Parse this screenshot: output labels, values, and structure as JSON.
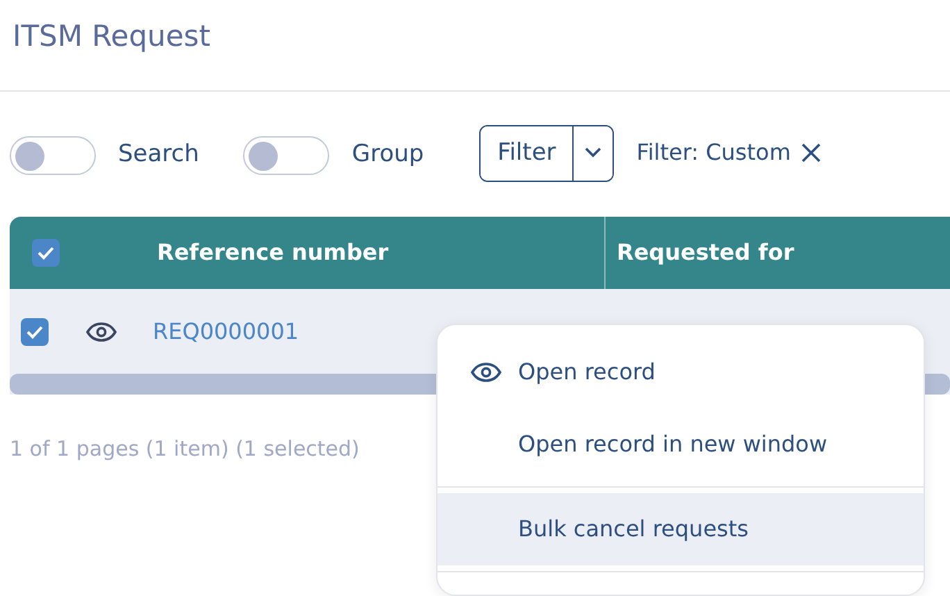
{
  "title": "ITSM Request",
  "toggles": [
    {
      "label": "Search",
      "on": false
    },
    {
      "label": "Group",
      "on": false
    }
  ],
  "filter": {
    "label": "Filter",
    "active_filter": "Filter: Custom"
  },
  "table": {
    "select_all": true,
    "columns": [
      "Reference number",
      "Requested for"
    ],
    "rows": [
      {
        "selected": true,
        "reference": "REQ0000001"
      }
    ]
  },
  "pager": "1 of 1 pages (1 item) (1 selected)",
  "context_menu": [
    {
      "label": "Open record",
      "kind": "icon",
      "selected": false
    },
    {
      "label": "Open record in new window",
      "kind": "plain",
      "selected": false
    },
    {
      "kind": "divider"
    },
    {
      "label": "Bulk cancel requests",
      "kind": "plain",
      "selected": true
    },
    {
      "kind": "divider"
    }
  ]
}
